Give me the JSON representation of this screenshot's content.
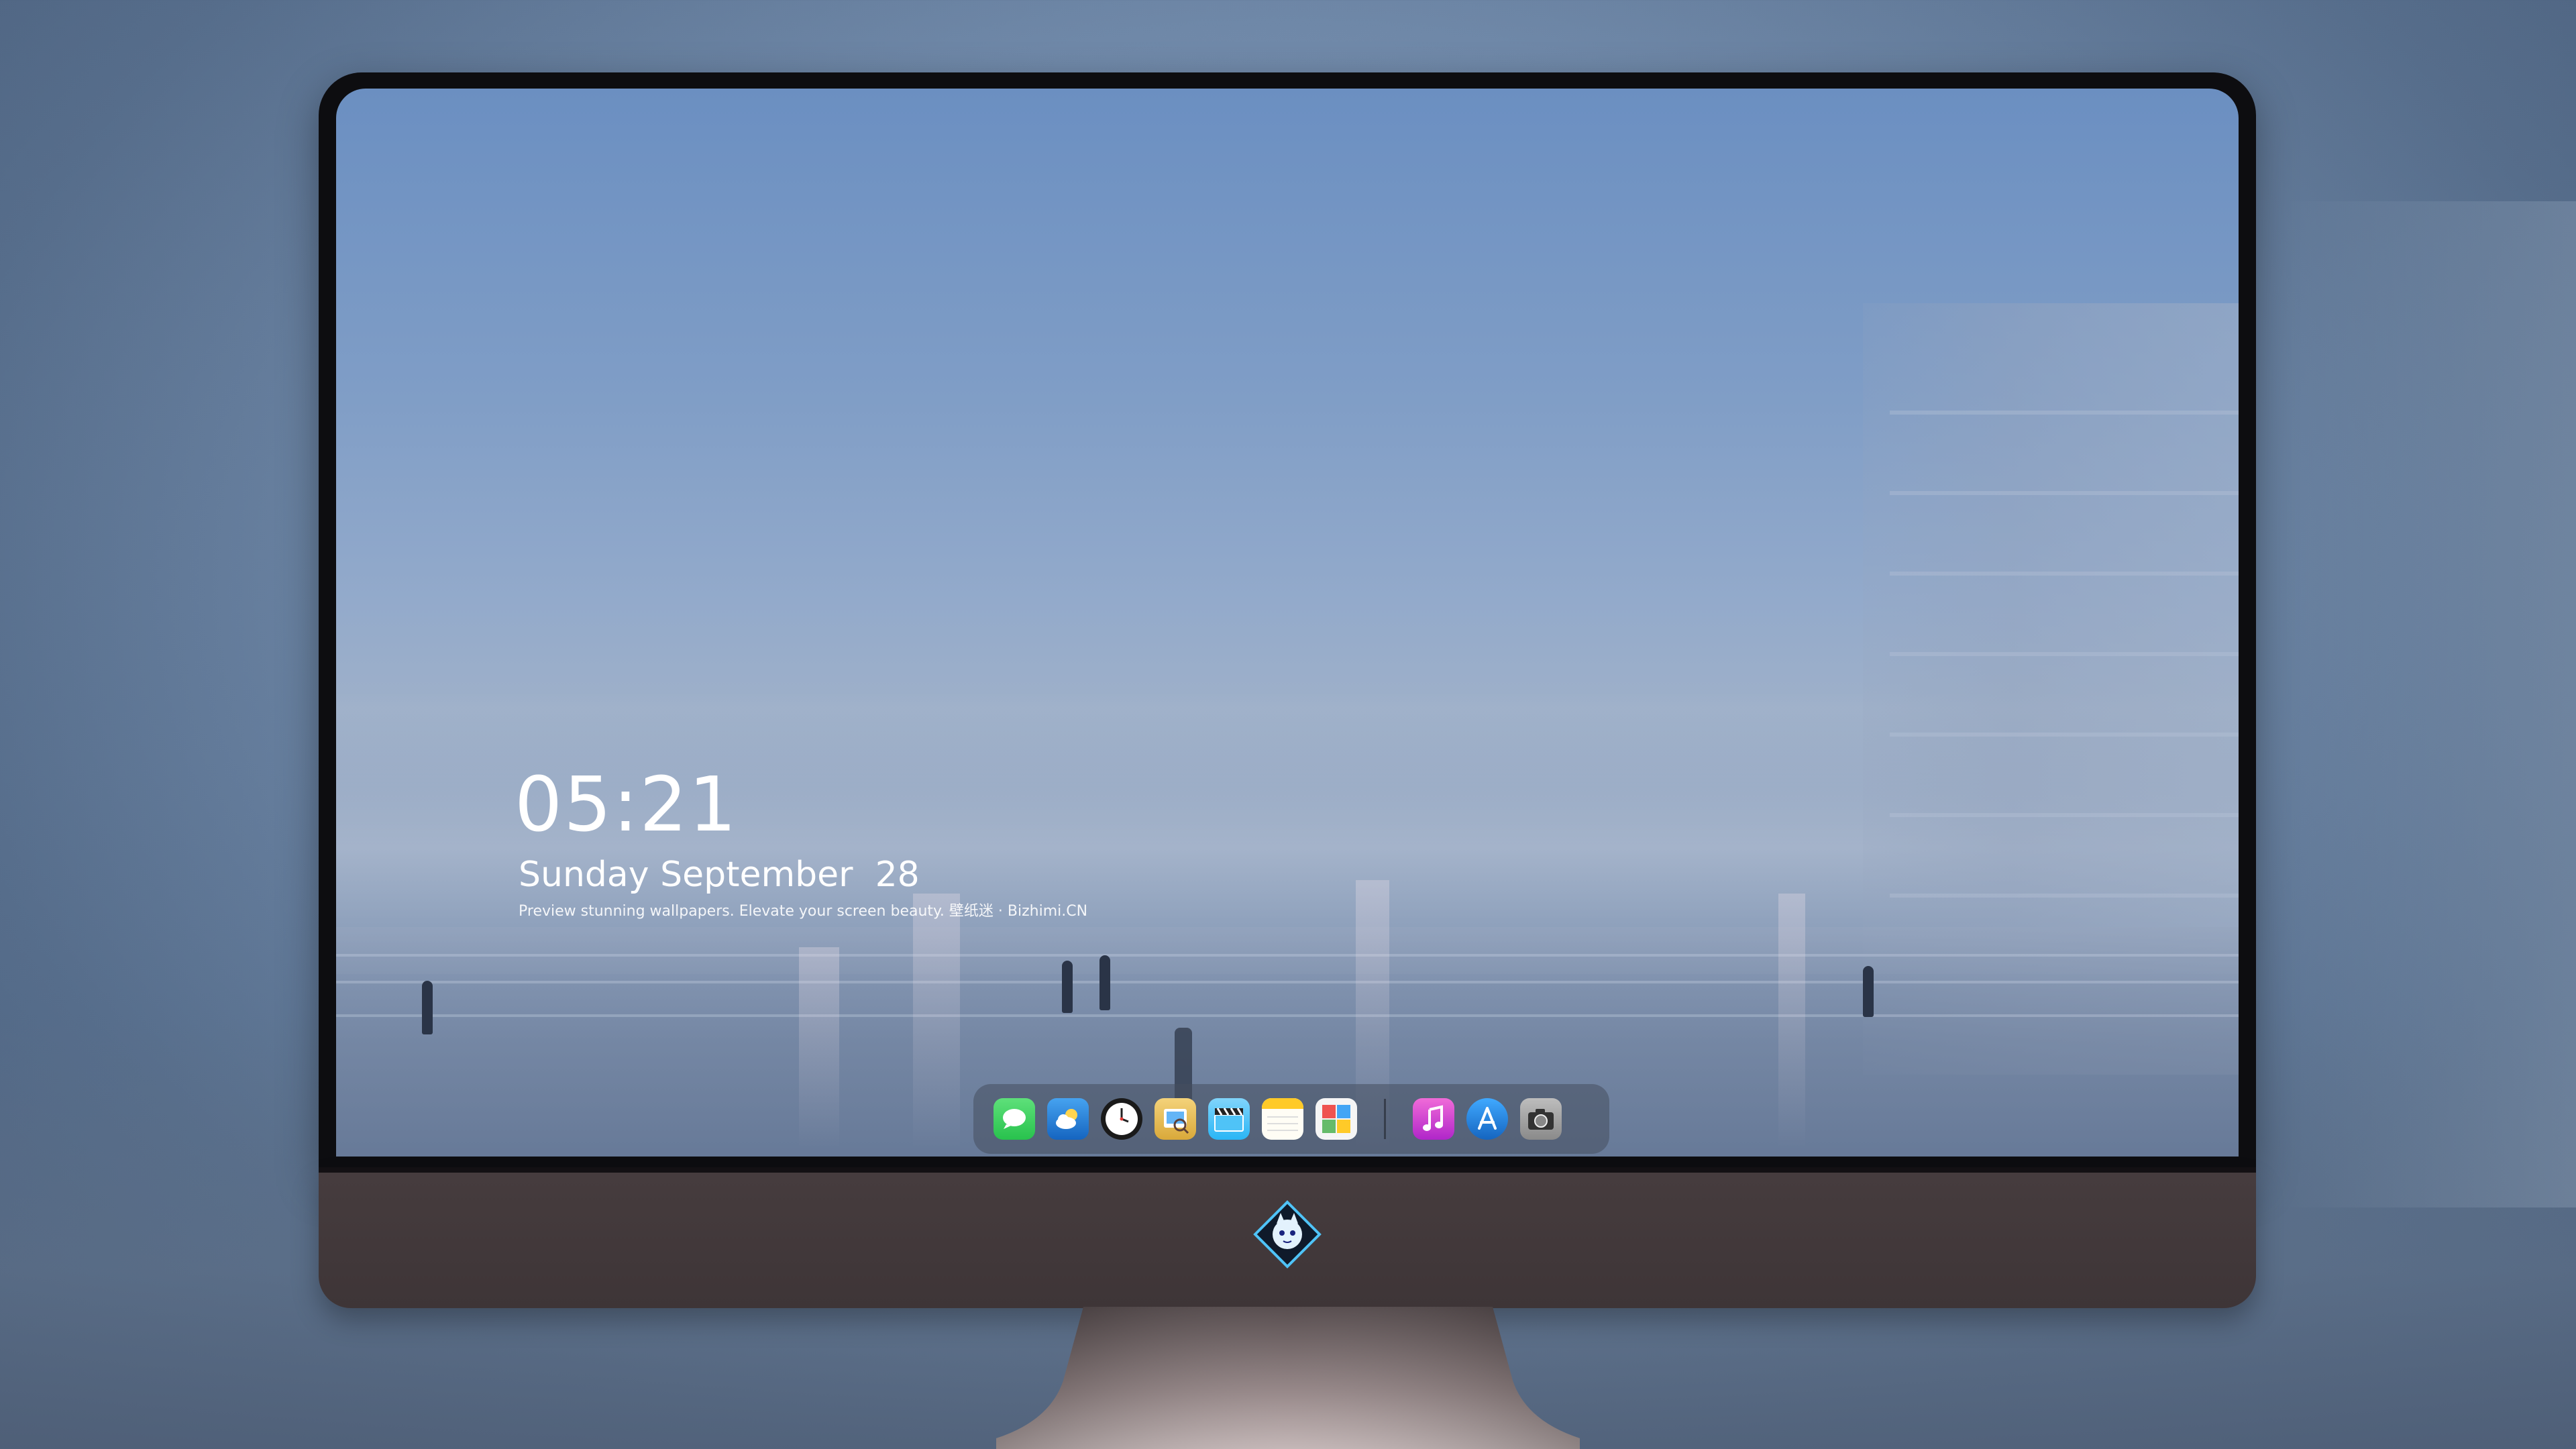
{
  "lockscreen": {
    "time": "05:21",
    "date": "Sunday September  28",
    "tagline": "Preview stunning wallpapers. Elevate your screen beauty. 壁纸迷 · Bizhimi.CN"
  },
  "dock": {
    "apps": [
      {
        "name": "Messages",
        "icon": "messages-icon",
        "color": "#34c759"
      },
      {
        "name": "Weather",
        "icon": "weather-icon",
        "color": "#1e88e5"
      },
      {
        "name": "Clock",
        "icon": "clock-icon",
        "color": "#111111"
      },
      {
        "name": "Preview",
        "icon": "preview-icon",
        "color": "#e8c15a"
      },
      {
        "name": "Clapper",
        "icon": "clapper-icon",
        "color": "#4fc3f7"
      },
      {
        "name": "Notes",
        "icon": "notes-icon",
        "color": "#ffd54f"
      },
      {
        "name": "Photos",
        "icon": "photos-icon",
        "color": "#66bb6a"
      },
      {
        "name": "Music",
        "icon": "music-icon",
        "color": "#e040fb"
      },
      {
        "name": "App Store",
        "icon": "app-store-icon",
        "color": "#1e88e5"
      },
      {
        "name": "Camera",
        "icon": "camera-icon",
        "color": "#9e9e9e"
      }
    ]
  },
  "monitor": {
    "brand_logo": "brand-logo-icon"
  }
}
